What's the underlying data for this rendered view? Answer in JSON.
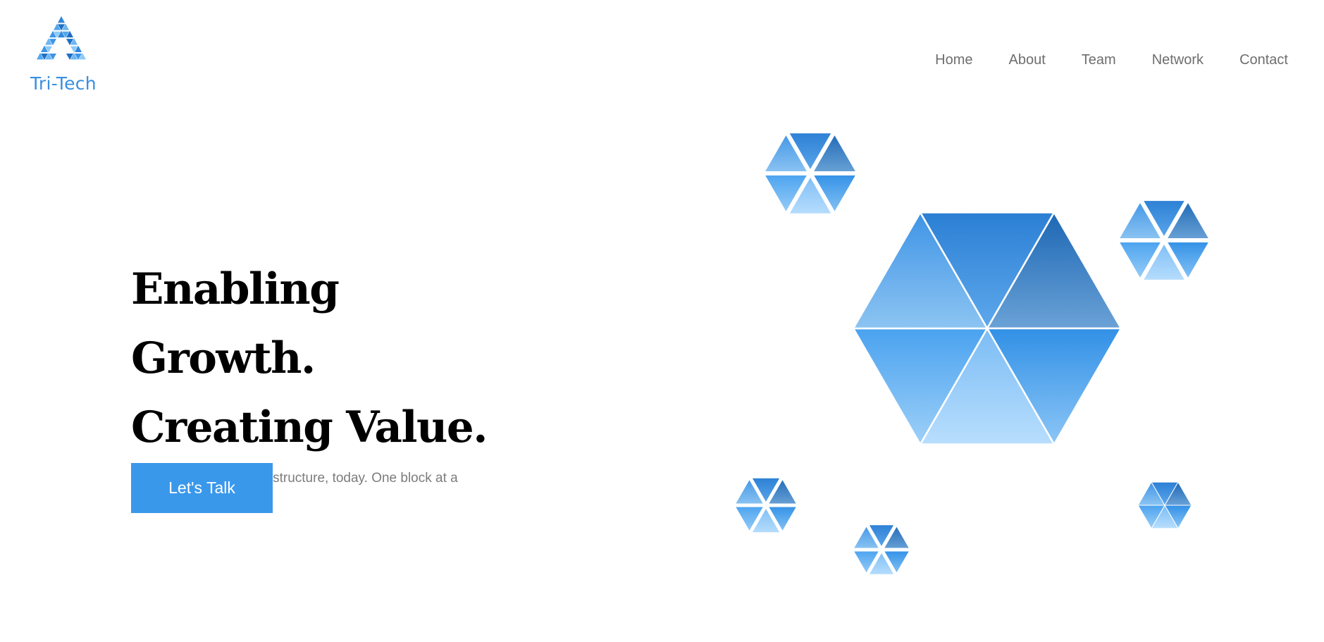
{
  "brand": {
    "name": "Tri-Tech",
    "logo_icon": "triangle-mosaic-icon"
  },
  "nav": {
    "items": [
      {
        "label": "Home"
      },
      {
        "label": "About"
      },
      {
        "label": "Team"
      },
      {
        "label": "Network"
      },
      {
        "label": "Contact"
      }
    ]
  },
  "hero": {
    "headline_line1": "Enabling Growth.",
    "headline_line2": "Creating Value.",
    "subtitle": "Building tomorrow's infastructure, today. One block at a time.",
    "cta_label": "Let's Talk"
  },
  "colors": {
    "brand_blue": "#3a8fe0",
    "button_blue": "#3a98eb",
    "nav_text": "#6e6e6e",
    "subtitle_text": "#7c7c7c"
  },
  "illustration": {
    "icon": "hexagon-cluster-icon"
  }
}
